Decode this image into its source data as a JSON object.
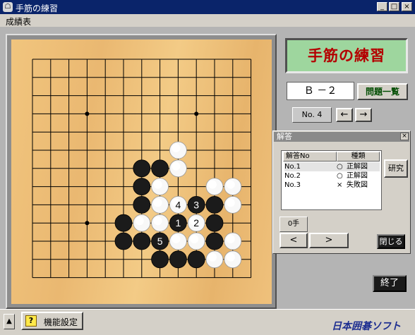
{
  "window": {
    "title": "手筋の練習",
    "minimize": "_",
    "maximize": "□",
    "close": "×"
  },
  "menu": {
    "item": "成績表"
  },
  "panel": {
    "title": "手筋の練習",
    "problem_code": "Ｂ －２",
    "problem_list_label": "問題一覧",
    "problem_no": "No. 4",
    "prev_label": "←",
    "next_label": "→"
  },
  "answer_window": {
    "title": "解答",
    "close": "×",
    "columns": [
      "解答No",
      "種類"
    ],
    "rows": [
      {
        "no": "No.1",
        "mark": "○",
        "kind": "正解図"
      },
      {
        "no": "No.2",
        "mark": "○",
        "kind": "正解図"
      },
      {
        "no": "No.3",
        "mark": "×",
        "kind": "失敗図"
      }
    ],
    "study_label": "研究",
    "move_count": "0手",
    "back_label": "<",
    "forward_label": ">",
    "close_label": "閉じる"
  },
  "exit_label": "終了",
  "bottom": {
    "toggle_label": "▲",
    "help_icon_label": "?",
    "settings_label": "機能設定",
    "brand": "日本囲碁ソフト"
  },
  "board": {
    "size": 13,
    "hoshi": [
      [
        3,
        3
      ],
      [
        3,
        9
      ],
      [
        9,
        3
      ]
    ],
    "stones": [
      {
        "color": "white",
        "col": 8,
        "row": 5
      },
      {
        "color": "white",
        "col": 8,
        "row": 6
      },
      {
        "color": "black",
        "col": 6,
        "row": 6
      },
      {
        "color": "black",
        "col": 7,
        "row": 6
      },
      {
        "color": "black",
        "col": 6,
        "row": 7
      },
      {
        "color": "white",
        "col": 7,
        "row": 7
      },
      {
        "color": "white",
        "col": 10,
        "row": 7
      },
      {
        "color": "white",
        "col": 11,
        "row": 7
      },
      {
        "color": "black",
        "col": 6,
        "row": 8
      },
      {
        "color": "white",
        "col": 7,
        "row": 8
      },
      {
        "color": "white",
        "col": 8,
        "row": 8,
        "label": "4"
      },
      {
        "color": "black",
        "col": 9,
        "row": 8,
        "label": "3"
      },
      {
        "color": "black",
        "col": 10,
        "row": 8
      },
      {
        "color": "white",
        "col": 11,
        "row": 8
      },
      {
        "color": "black",
        "col": 5,
        "row": 9
      },
      {
        "color": "white",
        "col": 6,
        "row": 9
      },
      {
        "color": "white",
        "col": 7,
        "row": 9
      },
      {
        "color": "black",
        "col": 8,
        "row": 9,
        "label": "1"
      },
      {
        "color": "white",
        "col": 9,
        "row": 9,
        "label": "2"
      },
      {
        "color": "black",
        "col": 10,
        "row": 9
      },
      {
        "color": "black",
        "col": 5,
        "row": 10
      },
      {
        "color": "black",
        "col": 6,
        "row": 10
      },
      {
        "color": "black",
        "col": 7,
        "row": 10,
        "label": "5"
      },
      {
        "color": "white",
        "col": 8,
        "row": 10
      },
      {
        "color": "white",
        "col": 9,
        "row": 10
      },
      {
        "color": "black",
        "col": 10,
        "row": 10
      },
      {
        "color": "white",
        "col": 11,
        "row": 10
      },
      {
        "color": "black",
        "col": 7,
        "row": 11
      },
      {
        "color": "black",
        "col": 8,
        "row": 11
      },
      {
        "color": "black",
        "col": 9,
        "row": 11
      },
      {
        "color": "white",
        "col": 10,
        "row": 11
      },
      {
        "color": "white",
        "col": 11,
        "row": 11
      }
    ]
  },
  "colors": {
    "titlebar": "#0a246a",
    "board": "#eebe77",
    "badge": "#9ed69e",
    "badge_text": "#b40000",
    "brand": "#1c2d90"
  }
}
